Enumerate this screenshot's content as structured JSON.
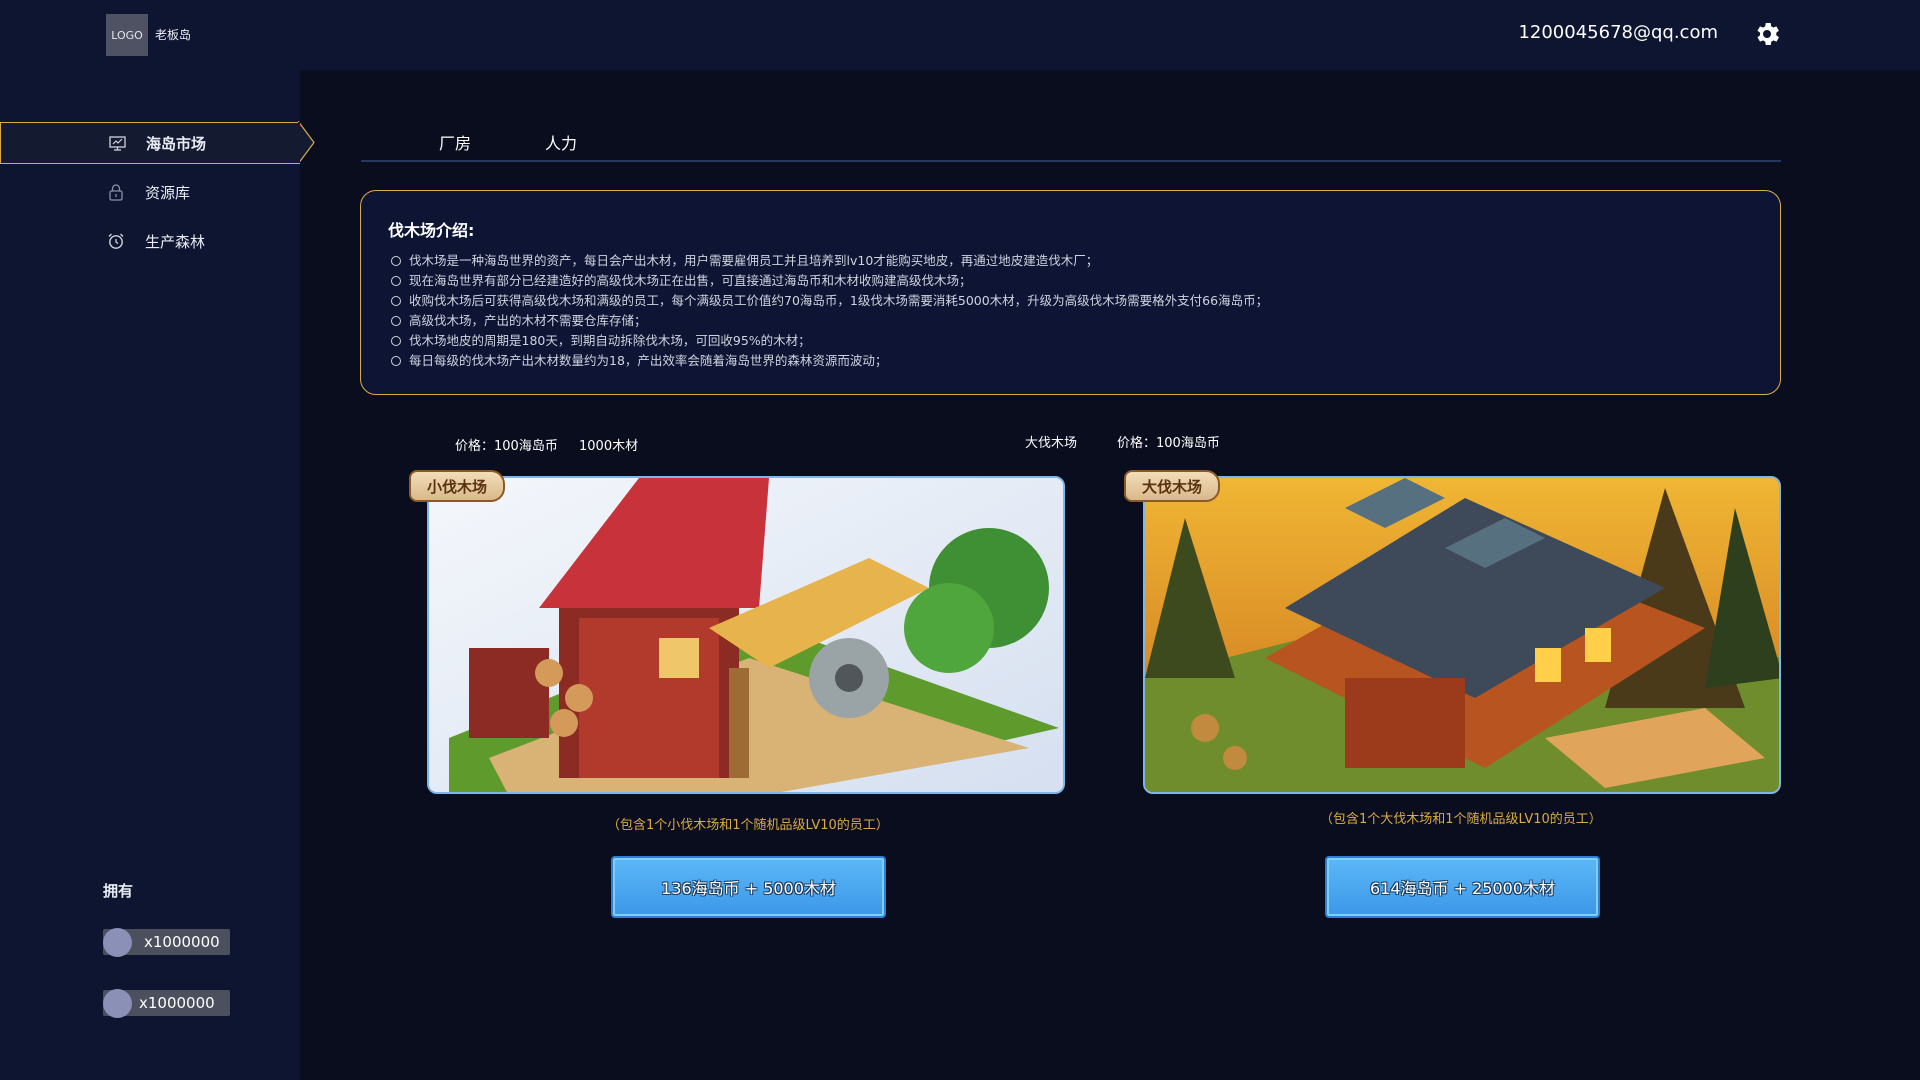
{
  "header": {
    "logo_text": "LOGO",
    "app_name": "老板岛",
    "email": "1200045678@qq.com",
    "settings_icon": "gear-icon"
  },
  "sidebar": {
    "items": [
      {
        "label": "海岛市场",
        "icon": "monitor-chart-icon",
        "active": true
      },
      {
        "label": "资源库",
        "icon": "lock-icon",
        "active": false
      },
      {
        "label": "生产森林",
        "icon": "alarm-clock-icon",
        "active": false
      }
    ],
    "own_title": "拥有",
    "holdings": [
      {
        "qty": "x1000000"
      },
      {
        "qty": "x1000000"
      }
    ]
  },
  "tabs": [
    {
      "label": "厂房"
    },
    {
      "label": "人力"
    }
  ],
  "intro": {
    "title": "伐木场介绍:",
    "items": [
      "伐木场是一种海岛世界的资产，每日会产出木材，用户需要雇佣员工并且培养到lv10才能购买地皮，再通过地皮建造伐木厂；",
      "现在海岛世界有部分已经建造好的高级伐木场正在出售，可直接通过海岛币和木材收购建高级伐木场；",
      "收购伐木场后可获得高级伐木场和满级的员工，每个满级员工价值约70海岛币，1级伐木场需要消耗5000木材，升级为高级伐木场需要格外支付66海岛币；",
      "高级伐木场，产出的木材不需要仓库存储；",
      "伐木场地皮的周期是180天，到期自动拆除伐木场，可回收95%的木材；",
      "每日每级的伐木场产出木材数量约为18，产出效率会随着海岛世界的森林资源而波动；"
    ]
  },
  "products": [
    {
      "price_label": "价格：100海岛币",
      "extra_label": "1000木材",
      "badge": "小伐木场",
      "description": "（包含1个小伐木场和1个随机品级LV10的员工）",
      "button": "136海岛币 + 5000木材"
    },
    {
      "name_label": "大伐木场",
      "price_label": "价格：100海岛币",
      "badge": "大伐木场",
      "description": "（包含1个大伐木场和1个随机品级LV10的员工）",
      "button": "614海岛币 + 25000木材"
    }
  ],
  "colors": {
    "background": "#0a0d1e",
    "panel": "#0e1530",
    "accent_gold": "#d9ac48",
    "button_blue": "#4aa8f0"
  }
}
